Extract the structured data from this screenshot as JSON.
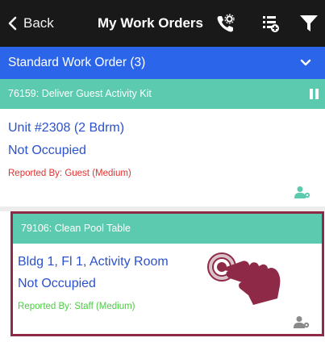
{
  "nav": {
    "back_label": "Back",
    "title": "My Work Orders",
    "icons": [
      "phone-settings-icon",
      "list-add-icon",
      "filter-icon"
    ]
  },
  "group": {
    "label": "Standard Work Order (3)"
  },
  "orders": [
    {
      "header": "76159: Deliver Guest Activity Kit",
      "location": "Unit #2308 (2 Bdrm)",
      "occupancy": "Not Occupied",
      "reported": "Reported By: Guest  (Medium)",
      "reported_color": "#e0312f"
    },
    {
      "header": "79106: Clean Pool Table",
      "location": "Bldg 1, Fl 1, Activity Room",
      "occupancy": "Not Occupied",
      "reported": "Reported By: Staff  (Medium)",
      "reported_color": "#4ccd43"
    }
  ],
  "colors": {
    "nav_bg": "#191919",
    "group_bg": "#2b66ea",
    "header_bg": "#5ccaae",
    "link_blue": "#2b52cc",
    "highlight": "#8e2a48"
  }
}
